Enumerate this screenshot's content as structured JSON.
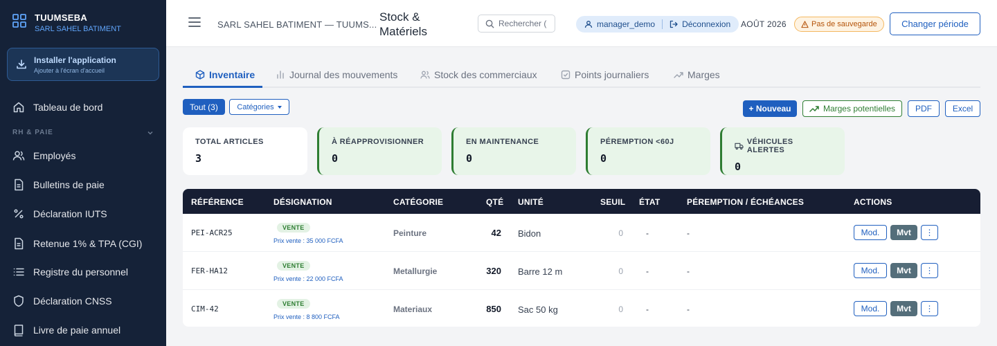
{
  "sidebar": {
    "brand_name": "TUUMSEBA",
    "brand_sub": "SARL SAHEL BATIMENT",
    "install_title": "Installer l'application",
    "install_sub": "Ajouter à l'écran d'accueil",
    "dashboard": "Tableau de bord",
    "section_label": "RH & PAIE",
    "items": [
      {
        "label": "Employés",
        "icon": "users-icon"
      },
      {
        "label": "Bulletins de paie",
        "icon": "document-icon"
      },
      {
        "label": "Déclaration IUTS",
        "icon": "percent-icon"
      },
      {
        "label": "Retenue 1% & TPA (CGI)",
        "icon": "document-icon"
      },
      {
        "label": "Registre du personnel",
        "icon": "list-icon"
      },
      {
        "label": "Déclaration CNSS",
        "icon": "shield-icon"
      },
      {
        "label": "Livre de paie annuel",
        "icon": "book-icon"
      }
    ]
  },
  "header": {
    "company": "SARL SAHEL BATIMENT — TUUMS...",
    "title": "Stock & Matériels",
    "search_placeholder": "Rechercher (",
    "user": "manager_demo",
    "logout": "Déconnexion",
    "period": "AOÛT 2026",
    "no_save": "Pas de sauvegarde",
    "change_period": "Changer période"
  },
  "tabs": [
    {
      "label": "Inventaire",
      "active": true
    },
    {
      "label": "Journal des mouvements",
      "active": false
    },
    {
      "label": "Stock des commerciaux",
      "active": false
    },
    {
      "label": "Points journaliers",
      "active": false
    },
    {
      "label": "Marges",
      "active": false
    }
  ],
  "filters": {
    "all": "Tout (3)",
    "categories": "Catégories"
  },
  "actions": {
    "new": "+ Nouveau",
    "margins": "Marges potentielles",
    "pdf": "PDF",
    "excel": "Excel"
  },
  "stats": [
    {
      "label": "TOTAL ARTICLES",
      "value": "3"
    },
    {
      "label": "À RÉAPPROVISIONNER",
      "value": "0"
    },
    {
      "label": "EN MAINTENANCE",
      "value": "0"
    },
    {
      "label": "PÉREMPTION <60J",
      "value": "0"
    },
    {
      "label": "VÉHICULES ALERTES",
      "value": "0"
    }
  ],
  "table": {
    "columns": [
      "RÉFÉRENCE",
      "DÉSIGNATION",
      "CATÉGORIE",
      "QTÉ",
      "UNITÉ",
      "SEUIL",
      "ÉTAT",
      "PÉREMPTION / ÉCHÉANCES",
      "ACTIONS"
    ],
    "rows": [
      {
        "ref": "PEI-ACR25",
        "badge": "VENTE",
        "price": "Prix vente : 35 000 FCFA",
        "category": "Peinture",
        "qty": "42",
        "unit": "Bidon",
        "seuil": "0",
        "etat": "-",
        "peremption": "-"
      },
      {
        "ref": "FER-HA12",
        "badge": "VENTE",
        "price": "Prix vente : 22 000 FCFA",
        "category": "Metallurgie",
        "qty": "320",
        "unit": "Barre 12 m",
        "seuil": "0",
        "etat": "-",
        "peremption": "-"
      },
      {
        "ref": "CIM-42",
        "badge": "VENTE",
        "price": "Prix vente : 8 800 FCFA",
        "category": "Materiaux",
        "qty": "850",
        "unit": "Sac 50 kg",
        "seuil": "0",
        "etat": "-",
        "peremption": "-"
      }
    ],
    "btn_mod": "Mod.",
    "btn_mvt": "Mvt",
    "btn_more": "⋮"
  },
  "colors": {
    "sidebar_bg": "#152238",
    "primary": "#1f5fbf",
    "success": "#2e7d32",
    "warning": "#b45309",
    "table_head": "#171e33"
  }
}
